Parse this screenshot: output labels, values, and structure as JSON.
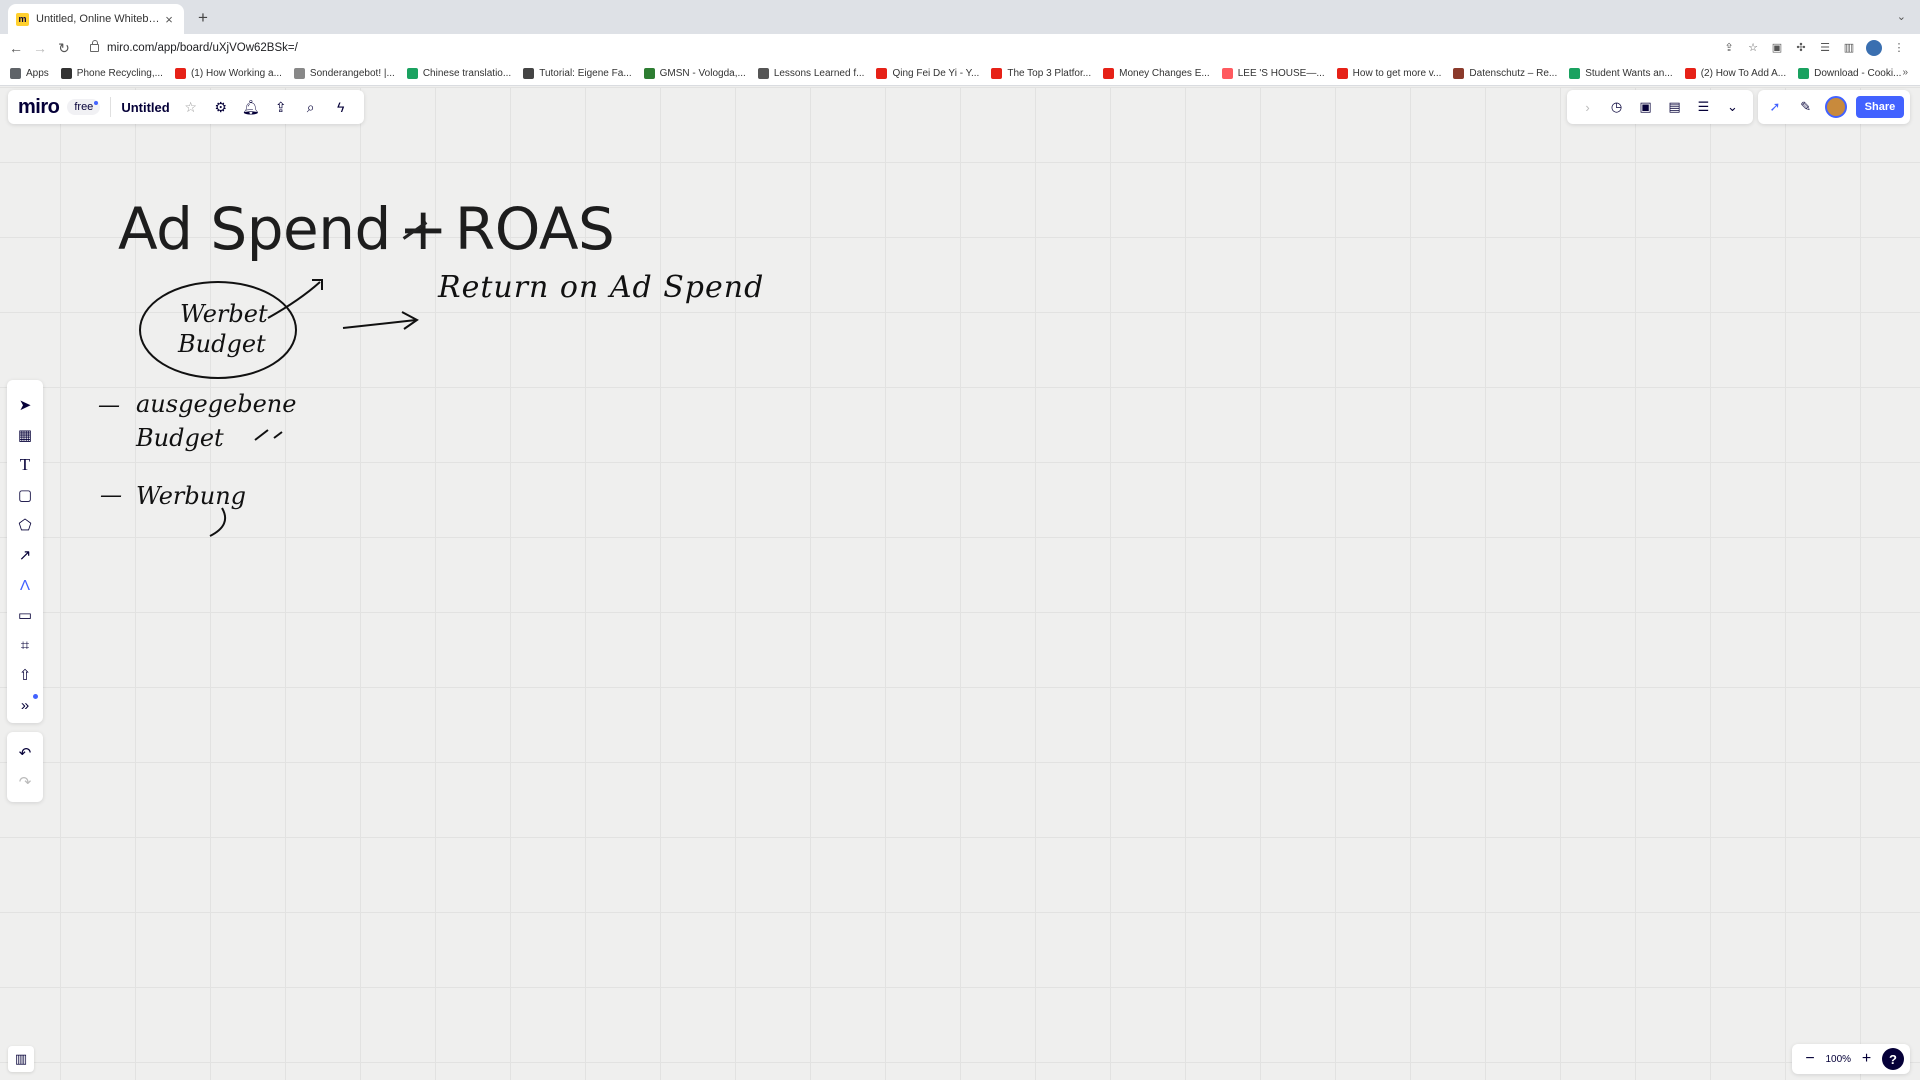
{
  "browser": {
    "tab_title": "Untitled, Online Whiteboard fo",
    "tab_favicon": "m",
    "new_tab": "+",
    "url": "miro.com/app/board/uXjVOw62BSk=/",
    "bookmarks": [
      {
        "label": "Apps",
        "color": "#5f6368"
      },
      {
        "label": "Phone Recycling,...",
        "color": "#333333"
      },
      {
        "label": "(1) How Working a...",
        "color": "#e62117"
      },
      {
        "label": "Sonderangebot! |...",
        "color": "#888888"
      },
      {
        "label": "Chinese translatio...",
        "color": "#1aa260"
      },
      {
        "label": "Tutorial: Eigene Fa...",
        "color": "#444444"
      },
      {
        "label": "GMSN - Vologda,...",
        "color": "#2e7d32"
      },
      {
        "label": "Lessons Learned f...",
        "color": "#555555"
      },
      {
        "label": "Qing Fei De Yi - Y...",
        "color": "#e62117"
      },
      {
        "label": "The Top 3 Platfor...",
        "color": "#e62117"
      },
      {
        "label": "Money Changes E...",
        "color": "#e62117"
      },
      {
        "label": "LEE 'S HOUSE—...",
        "color": "#ff5a5f"
      },
      {
        "label": "How to get more v...",
        "color": "#e62117"
      },
      {
        "label": "Datenschutz – Re...",
        "color": "#8b3a2b"
      },
      {
        "label": "Student Wants an...",
        "color": "#1aa260"
      },
      {
        "label": "(2) How To Add A...",
        "color": "#e62117"
      },
      {
        "label": "Download - Cooki...",
        "color": "#1aa260"
      }
    ],
    "bookmarks_more": "»"
  },
  "miro": {
    "logo": "miro",
    "plan_badge": "free",
    "board_title": "Untitled",
    "share_label": "Share",
    "zoom_level": "100%",
    "zoom_out": "−",
    "zoom_in": "+",
    "help": "?",
    "accent_color": "#4262ff"
  },
  "canvas": {
    "heading_left": "Ad Spend",
    "heading_operator": "+",
    "heading_right": "ROAS",
    "handwriting": {
      "circle_text_line1": "Werbet",
      "circle_text_line2": "Budget",
      "roas_meaning": "Return on Ad Spend",
      "bullet1_line1": "ausgegebene",
      "bullet1_line2": "Budget",
      "bullet2": "Werbung",
      "bullet_dash": "—"
    }
  }
}
